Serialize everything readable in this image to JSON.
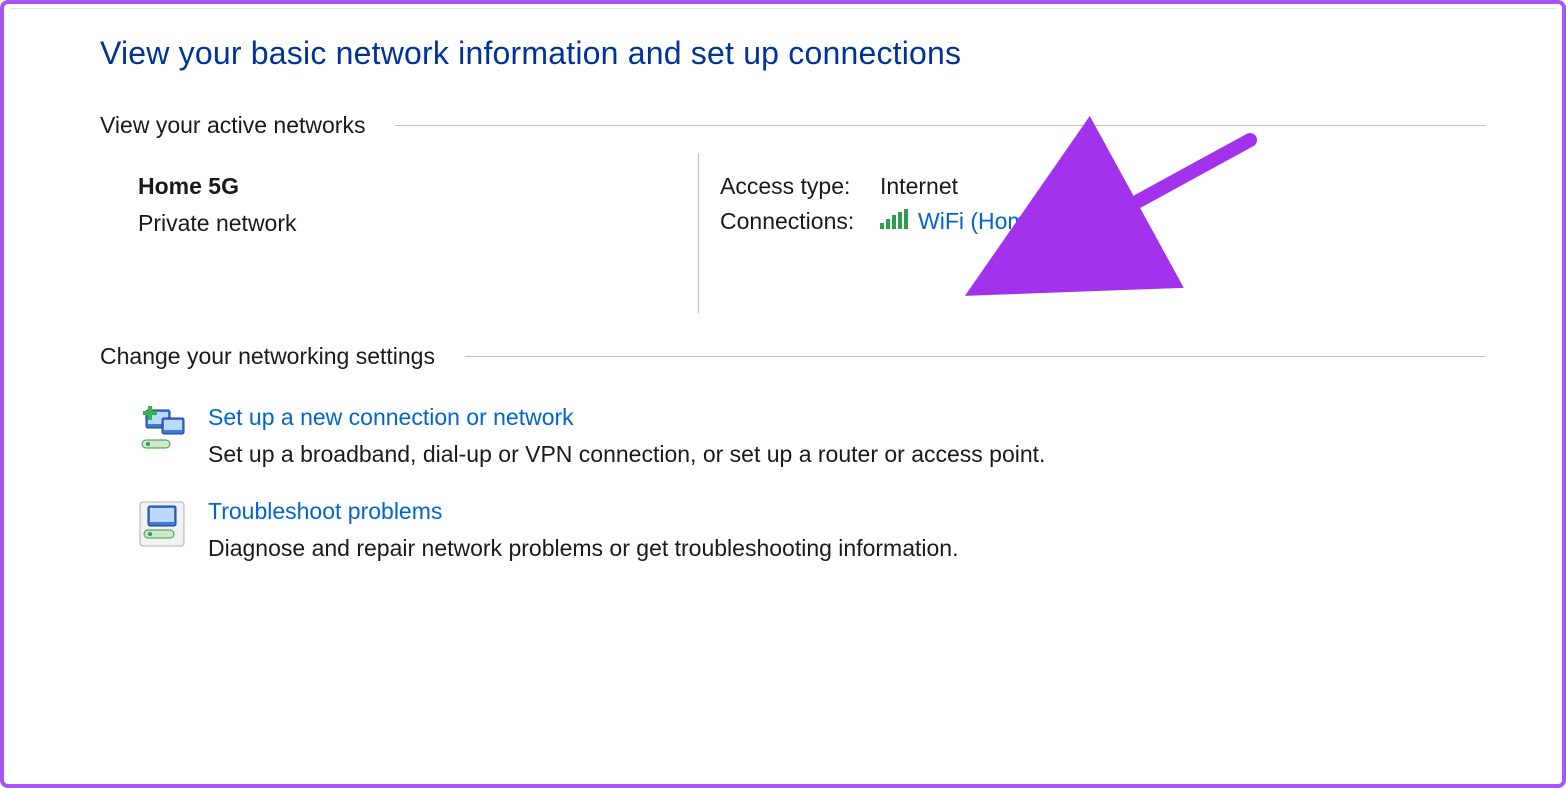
{
  "page": {
    "title": "View your basic network information and set up connections"
  },
  "sections": {
    "active_networks_label": "View your active networks",
    "change_settings_label": "Change your networking settings"
  },
  "active_network": {
    "name": "Home 5G",
    "type": "Private network",
    "access_type_label": "Access type:",
    "access_type_value": "Internet",
    "connections_label": "Connections:",
    "connection_link": "WiFi (Home 5G)",
    "signal_icon": "wifi-signal-icon"
  },
  "change_items": [
    {
      "icon": "new-connection-icon",
      "title": "Set up a new connection or network",
      "description": "Set up a broadband, dial-up or VPN connection, or set up a router or access point."
    },
    {
      "icon": "troubleshoot-icon",
      "title": "Troubleshoot problems",
      "description": "Diagnose and repair network problems or get troubleshooting information."
    }
  ],
  "annotation": {
    "arrow_color": "#a232ec"
  }
}
